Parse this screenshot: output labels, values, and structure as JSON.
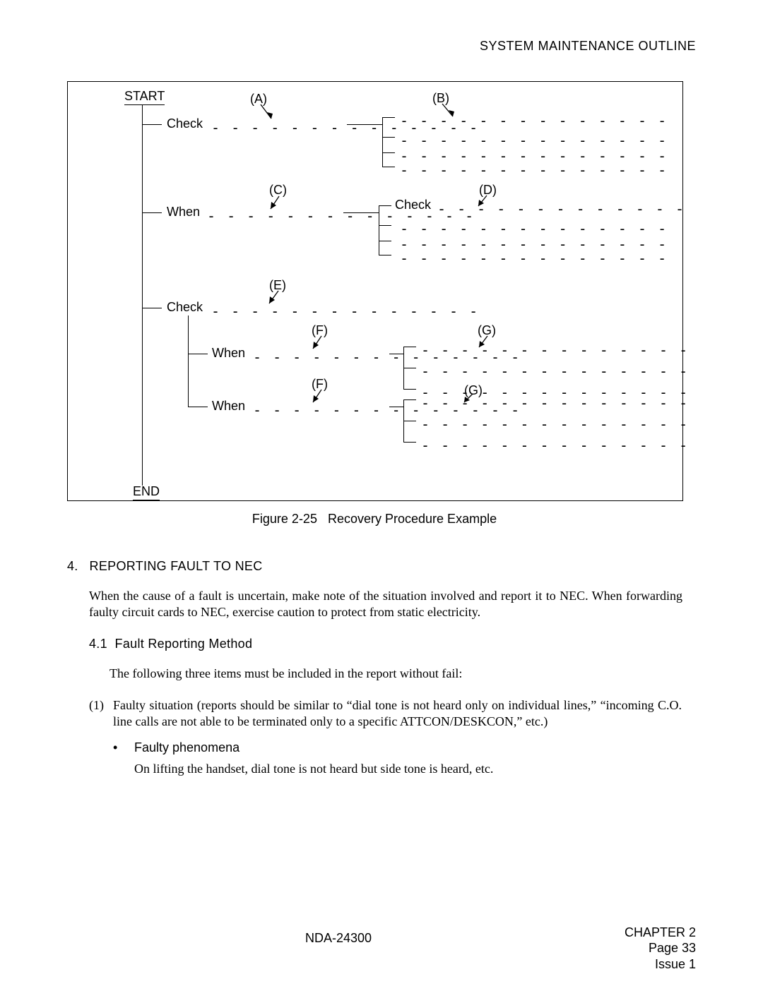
{
  "header": {
    "title": "SYSTEM MAINTENANCE OUTLINE"
  },
  "diagram": {
    "start": "START",
    "end": "END",
    "labels": {
      "check": "Check",
      "when": "When",
      "A": "(A)",
      "B": "(B)",
      "C": "(C)",
      "D": "(D)",
      "E": "(E)",
      "F": "(F)",
      "G": "(G)"
    },
    "dash_short": "- - - - - - - - - - - - - -",
    "dash_med": "- - - - - - - - - - - - -"
  },
  "figure": {
    "caption_label": "Figure 2-25",
    "caption_title": "Recovery Procedure Example"
  },
  "section4": {
    "num": "4.",
    "title": "REPORTING FAULT TO NEC",
    "para": "When the cause of a fault is uncertain, make note of the situation involved and report it to NEC. When forwarding faulty circuit cards to NEC, exercise caution to protect from static electricity."
  },
  "section41": {
    "num": "4.1",
    "title": "Fault Reporting Method",
    "intro": "The following three items must be included in the report without fail:",
    "item1_num": "(1)",
    "item1_text": "Faulty situation (reports should be similar to “dial tone is not heard only on individual lines,” “incoming C.O. line calls are not able to be terminated only to a specific ATTCON/DESKCON,” etc.)",
    "bullet": "•",
    "bullet_title": "Faulty phenomena",
    "bullet_body": "On lifting the handset, dial tone is not heard but side tone is heard, etc."
  },
  "footer": {
    "center": "NDA-24300",
    "chapter": "CHAPTER 2",
    "page": "Page 33",
    "issue": "Issue 1"
  }
}
